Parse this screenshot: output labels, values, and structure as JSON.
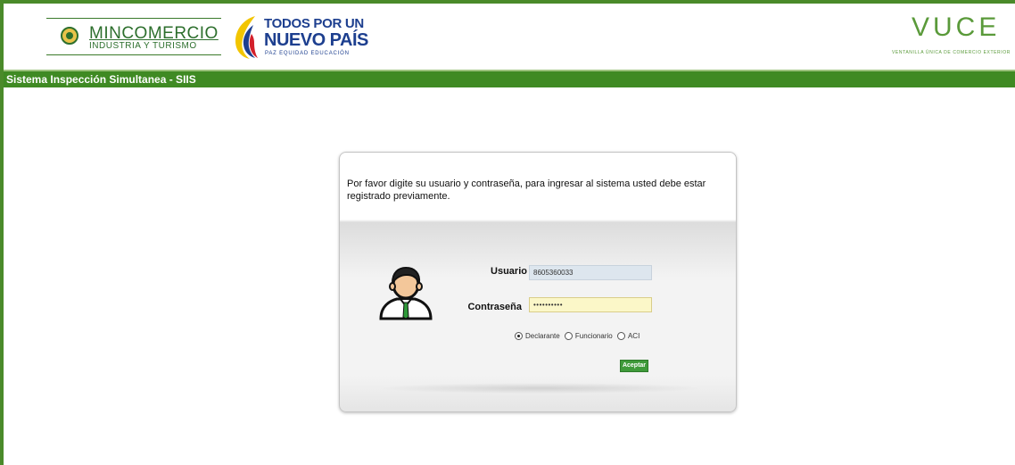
{
  "header": {
    "mincomercio_title": "MINCOMERCIO",
    "mincomercio_subtitle": "INDUSTRIA Y TURISMO",
    "campaign_line1": "TODOS POR UN",
    "campaign_line2": "NUEVO PAÍS",
    "campaign_line3": "PAZ   EQUIDAD   EDUCACIÓN",
    "vuce_title": "VUCE",
    "vuce_subtitle": "VENTANILLA ÚNICA DE COMERCIO EXTERIOR"
  },
  "titlebar": {
    "text": "Sistema Inspección Simultanea - SIIS"
  },
  "login": {
    "message": "Por favor digite su usuario y contraseña, para ingresar al sistema usted debe estar registrado previamente.",
    "user_label": "Usuario",
    "user_value": "8605360033",
    "password_label": "Contraseña",
    "password_value": "••••••••••",
    "roles": [
      {
        "label": "Declarante",
        "checked": true
      },
      {
        "label": "Funcionario",
        "checked": false
      },
      {
        "label": "ACI",
        "checked": false
      }
    ],
    "submit_label": "Aceptar"
  },
  "colors": {
    "brand_green": "#3f8a23",
    "button_green": "#3f9a3a",
    "campaign_blue": "#1d3f8f"
  }
}
